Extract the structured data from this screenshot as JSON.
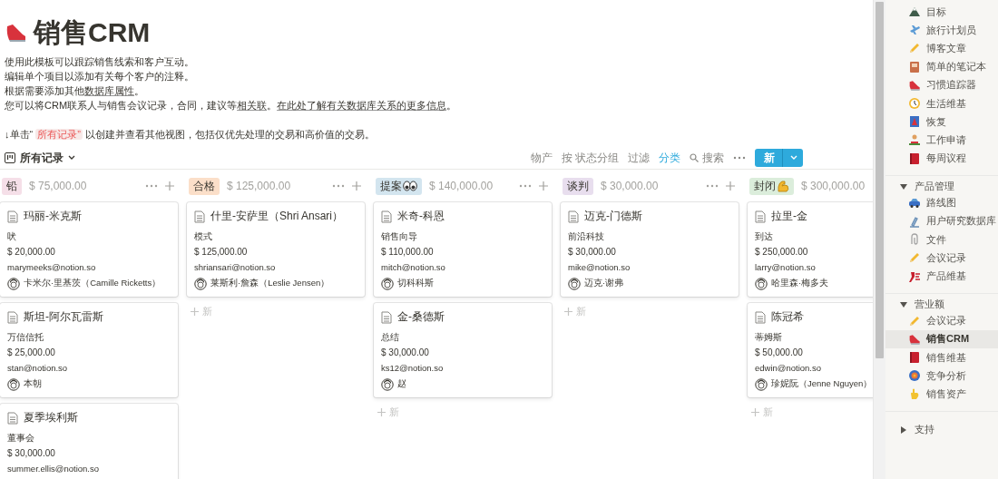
{
  "page": {
    "title": "销售CRM",
    "description": [
      [
        {
          "kind": "plain",
          "text": "使用此模板可以跟踪销售线索和客户互动。"
        }
      ],
      [
        {
          "kind": "plain",
          "text": "编辑单个项目以添加有关每个客户的注释。"
        }
      ],
      [
        {
          "kind": "plain",
          "text": "根据需要添加其他"
        },
        {
          "kind": "link",
          "text": "数据库属性"
        },
        {
          "kind": "plain",
          "text": "。"
        }
      ],
      [
        {
          "kind": "plain",
          "text": "您可以将CRM联系人与销售会议记录，合同，建议等"
        },
        {
          "kind": "link",
          "text": "相关联"
        },
        {
          "kind": "plain",
          "text": "。"
        },
        {
          "kind": "link",
          "text": "在此处了解有关数据库关系的更多信息"
        },
        {
          "kind": "plain",
          "text": "。"
        }
      ],
      [
        {
          "kind": "plain",
          "text": "↓单击“ "
        },
        {
          "kind": "code",
          "text": "所有记录”"
        },
        {
          "kind": "plain",
          "text": " 以创建并查看其他视图，包括仅优先处理的交易和高价值的交易。"
        }
      ]
    ]
  },
  "view": {
    "label": "所有记录"
  },
  "toolbar": {
    "items": [
      {
        "label": "物产",
        "active": false
      },
      {
        "label": "按 状态分组",
        "active": false
      },
      {
        "label": "过滤",
        "active": false
      },
      {
        "label": "分类",
        "active": true
      }
    ],
    "search": "搜索",
    "new_button": "新"
  },
  "board": {
    "columns": [
      {
        "tag": "铅",
        "color": "#f5dfe8",
        "total": "$ 75,000.00",
        "cards": [
          {
            "title": "玛丽-米克斯",
            "company": "吠",
            "amount": "$ 20,000.00",
            "email": "marymeeks@notion.so",
            "person": "卡米尔·里基茨（Camille Ricketts）"
          },
          {
            "title": "斯坦-阿尔瓦雷斯",
            "company": "万信信托",
            "amount": "$ 25,000.00",
            "email": "stan@notion.so",
            "person": "本朝"
          },
          {
            "title": "夏季埃利斯",
            "company": "董事会",
            "amount": "$ 30,000.00",
            "email": "summer.ellis@notion.so"
          }
        ]
      },
      {
        "tag": "合格",
        "color": "#fbdfc9",
        "total": "$ 125,000.00",
        "add_label": "新",
        "cards": [
          {
            "title": "什里-安萨里（Shri Ansari）",
            "company": "模式",
            "amount": "$ 125,000.00",
            "email": "shriansari@notion.so",
            "person": "莱斯利·詹森（Leslie Jensen）"
          }
        ]
      },
      {
        "tag": "提案",
        "color": "#d3e5ef",
        "total": "$ 140,000.00",
        "add_label": "新",
        "cards": [
          {
            "title": "米奇-科恩",
            "company": "销售向导",
            "amount": "$ 110,000.00",
            "email": "mitch@notion.so",
            "person": "切科科斯"
          },
          {
            "title": "金-桑德斯",
            "company": "总结",
            "amount": "$ 30,000.00",
            "email": "ks12@notion.so",
            "person": "赵"
          }
        ]
      },
      {
        "tag": "谈判",
        "color": "#e8deee",
        "total": "$ 30,000.00",
        "add_label": "新",
        "cards": [
          {
            "title": "迈克-门德斯",
            "company": "前沿科技",
            "amount": "$ 30,000.00",
            "email": "mike@notion.so",
            "person": "迈克·谢弗"
          }
        ]
      },
      {
        "tag": "封闭",
        "color": "#dbeddb",
        "total": "$ 300,000.00",
        "add_label": "新",
        "cards": [
          {
            "title": "拉里-金",
            "company": "到达",
            "amount": "$ 250,000.00",
            "email": "larry@notion.so",
            "person": "哈里森·梅多夫"
          },
          {
            "title": "陈冠希",
            "company": "蒂姆斯",
            "amount": "$ 50,000.00",
            "email": "edwin@notion.so",
            "person": "珍妮阮（Jenne Nguyen）"
          }
        ]
      }
    ]
  },
  "sidebar": {
    "groups": [
      {
        "items": [
          {
            "label": "目标",
            "selected": false
          },
          {
            "label": "旅行计划员",
            "selected": false
          },
          {
            "label": "博客文章",
            "selected": false
          },
          {
            "label": "简单的笔记本",
            "selected": false
          },
          {
            "label": "习惯追踪器",
            "selected": false
          },
          {
            "label": "生活维基",
            "selected": false
          },
          {
            "label": "恢复",
            "selected": false
          },
          {
            "label": "工作申请",
            "selected": false
          },
          {
            "label": "每周议程",
            "selected": false
          }
        ]
      },
      {
        "title": "产品管理",
        "expanded": true,
        "items": [
          {
            "label": "路线图",
            "selected": false
          },
          {
            "label": "用户研究数据库",
            "selected": false
          },
          {
            "label": "文件",
            "selected": false
          },
          {
            "label": "会议记录",
            "selected": false
          },
          {
            "label": "产品维基",
            "selected": false
          }
        ]
      },
      {
        "title": "营业额",
        "expanded": true,
        "items": [
          {
            "label": "会议记录",
            "selected": false
          },
          {
            "label": "销售CRM",
            "selected": true
          },
          {
            "label": "销售维基",
            "selected": false
          },
          {
            "label": "竞争分析",
            "selected": false
          },
          {
            "label": "销售资产",
            "selected": false
          }
        ]
      },
      {
        "title": "支持",
        "expanded": false
      }
    ]
  }
}
